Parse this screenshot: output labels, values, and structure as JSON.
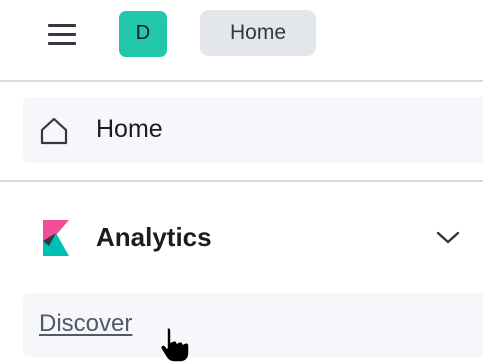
{
  "header": {
    "avatar_initial": "D",
    "breadcrumb": "Home"
  },
  "nav": {
    "home_label": "Home",
    "analytics_label": "Analytics",
    "discover_label": "Discover"
  },
  "icons": {
    "menu": "hamburger-icon",
    "home": "home-icon",
    "analytics_logo": "kibana-logo-icon",
    "expand": "chevron-down-icon",
    "pointer": "hand-pointer-icon"
  },
  "colors": {
    "avatar_bg": "#21c7aa",
    "breadcrumb_bg": "#e3e6ea",
    "row_bg": "#f5f7fa",
    "logo_pink": "#f04e98",
    "logo_teal": "#00bfb3",
    "logo_dark": "#343741"
  }
}
